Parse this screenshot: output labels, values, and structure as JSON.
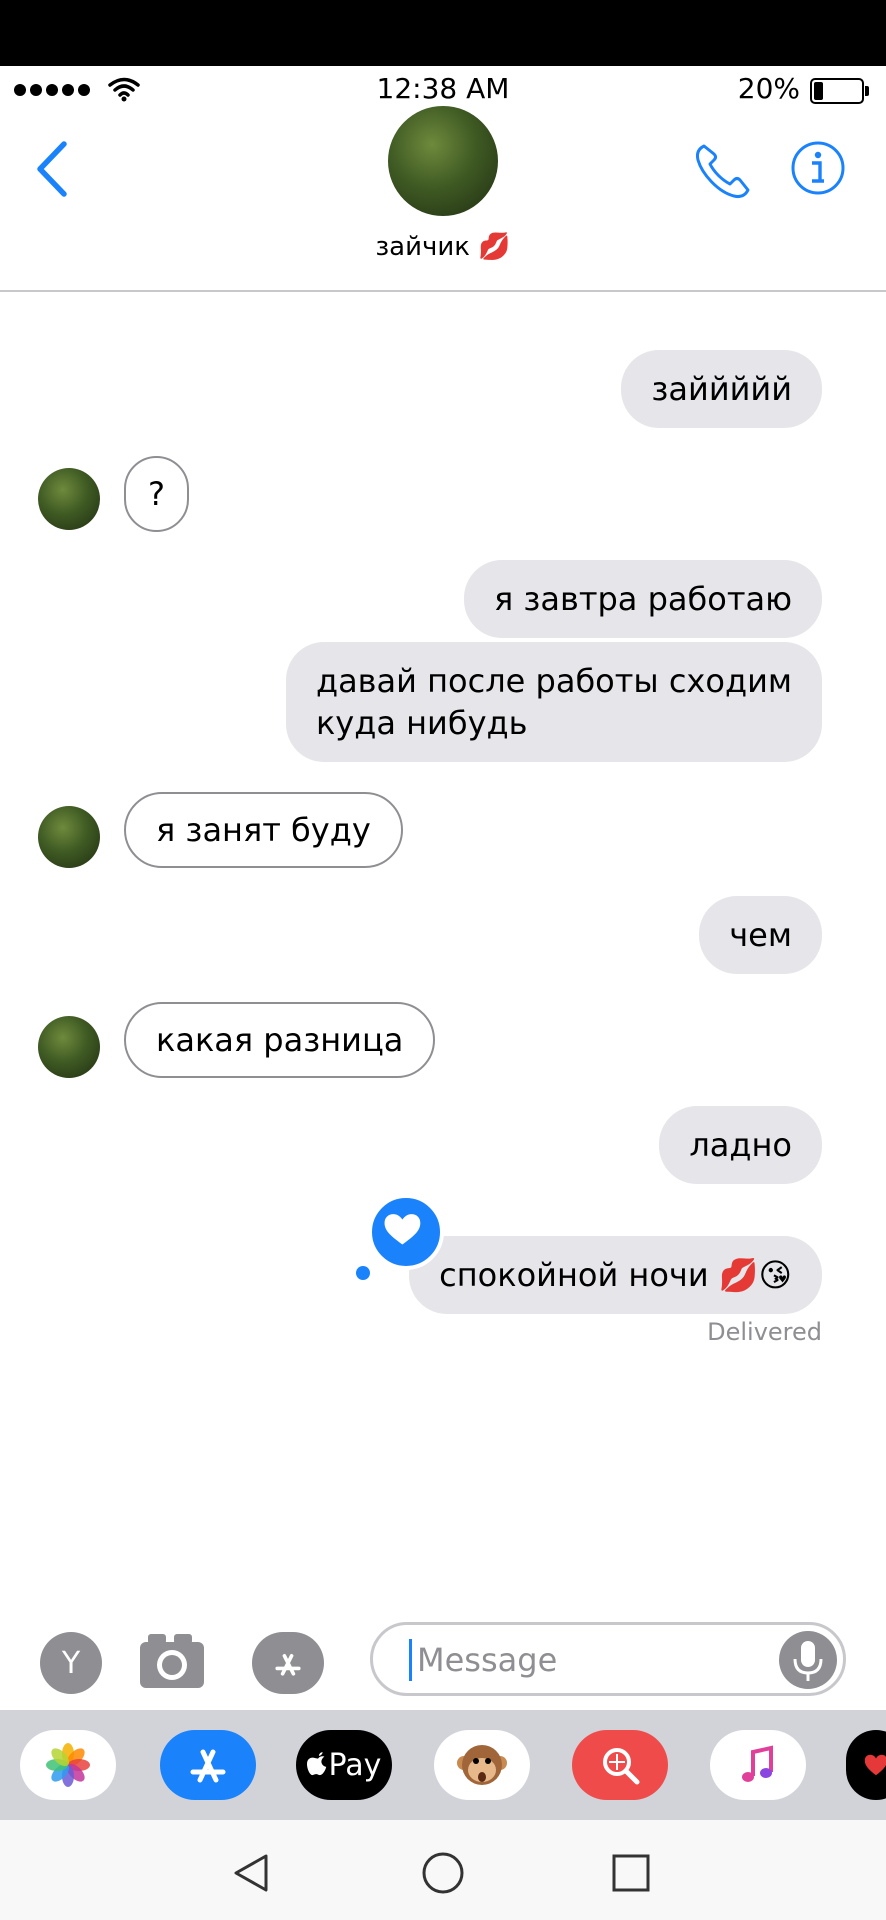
{
  "status_bar": {
    "time": "12:38 AM",
    "battery": "20%",
    "battery_level": 0.2
  },
  "header": {
    "contact_name": "зайчик 💋"
  },
  "messages": [
    {
      "dir": "out",
      "text": "заййййй"
    },
    {
      "dir": "in",
      "text": "?"
    },
    {
      "dir": "out",
      "text": "я завтра работаю"
    },
    {
      "dir": "out",
      "lines": [
        "давай после работы сходим",
        "куда нибудь"
      ]
    },
    {
      "dir": "in",
      "text": "я занят буду"
    },
    {
      "dir": "out",
      "text": "чем"
    },
    {
      "dir": "in",
      "text": "какая разница"
    },
    {
      "dir": "out",
      "text": "ладно"
    },
    {
      "dir": "out",
      "text": "спокойной ночи 💋😘",
      "tapback": "heart"
    }
  ],
  "delivered": "Delivered",
  "composer": {
    "profile_initial": "Y",
    "placeholder": "Message"
  },
  "app_drawer": {
    "apps": [
      "photos-icon",
      "app-store-icon",
      "apple-pay-icon",
      "animoji-icon",
      "search-images-icon",
      "music-icon",
      "heart-app-icon"
    ],
    "apple_pay_label": "Pay"
  },
  "colors": {
    "accent": "#1a82fb",
    "out_bubble": "#e5e5ea",
    "gray": "#8e8e93"
  }
}
